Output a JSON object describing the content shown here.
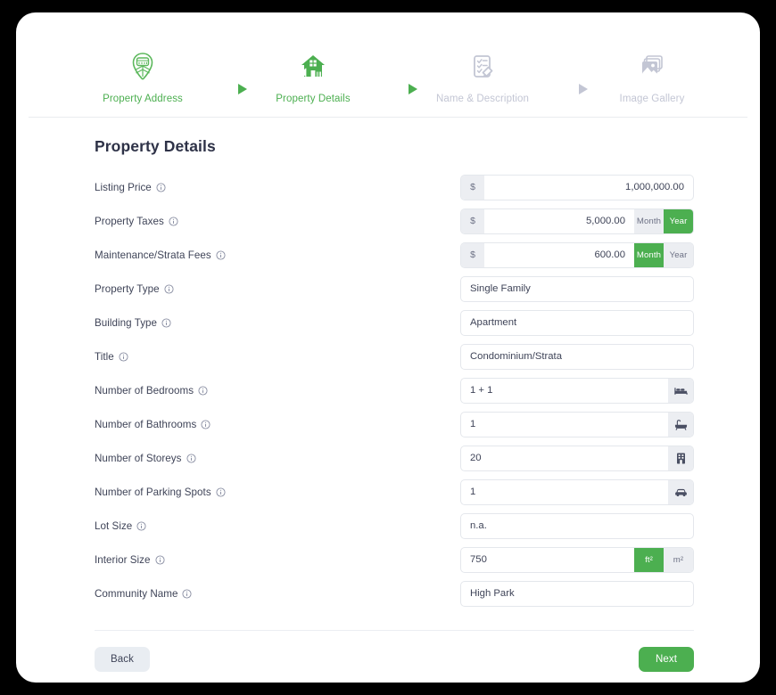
{
  "colors": {
    "accent": "#4caf50",
    "muted": "#c3c6d4",
    "text": "#3f4458",
    "field_bg": "#eceef2",
    "page_bg": "#000000",
    "card_bg": "#ffffff"
  },
  "stepper": {
    "steps": [
      {
        "label": "Property Address",
        "icon": "map-pin-icon",
        "state": "active"
      },
      {
        "label": "Property Details",
        "icon": "house-icon",
        "state": "active"
      },
      {
        "label": "Name & Description",
        "icon": "checklist-pencil-icon",
        "state": "inactive"
      },
      {
        "label": "Image Gallery",
        "icon": "image-gallery-icon",
        "state": "inactive"
      }
    ],
    "separators": [
      "arrow-right-icon",
      "arrow-right-icon",
      "arrow-right-icon"
    ]
  },
  "form": {
    "title": "Property Details",
    "info_icon": "info-icon",
    "fields": [
      {
        "label": "Listing Price",
        "prefix": "$",
        "value": "1,000,000.00",
        "align": "right"
      },
      {
        "label": "Property Taxes",
        "prefix": "$",
        "value": "5,000.00",
        "align": "right",
        "toggle": {
          "options": [
            "Month",
            "Year"
          ],
          "selected": "Year"
        }
      },
      {
        "label": "Maintenance/Strata Fees",
        "prefix": "$",
        "value": "600.00",
        "align": "right",
        "toggle": {
          "options": [
            "Month",
            "Year"
          ],
          "selected": "Month"
        }
      },
      {
        "label": "Property Type",
        "value": "Single Family",
        "align": "left"
      },
      {
        "label": "Building Type",
        "value": "Apartment",
        "align": "left"
      },
      {
        "label": "Title",
        "value": "Condominium/Strata",
        "align": "left"
      },
      {
        "label": "Number of Bedrooms",
        "value": "1 + 1",
        "align": "left",
        "trailing_icon": "bed-icon"
      },
      {
        "label": "Number of Bathrooms",
        "value": "1",
        "align": "left",
        "trailing_icon": "bathtub-icon"
      },
      {
        "label": "Number of Storeys",
        "value": "20",
        "align": "left",
        "trailing_icon": "building-icon"
      },
      {
        "label": "Number of Parking Spots",
        "value": "1",
        "align": "left",
        "trailing_icon": "car-icon"
      },
      {
        "label": "Lot Size",
        "value": "n.a.",
        "align": "left"
      },
      {
        "label": "Interior Size",
        "value": "750",
        "align": "left",
        "toggle": {
          "options": [
            "ft²",
            "m²"
          ],
          "selected": "ft²"
        }
      },
      {
        "label": "Community Name",
        "value": "High Park",
        "align": "left"
      }
    ]
  },
  "footer": {
    "back_label": "Back",
    "next_label": "Next"
  }
}
